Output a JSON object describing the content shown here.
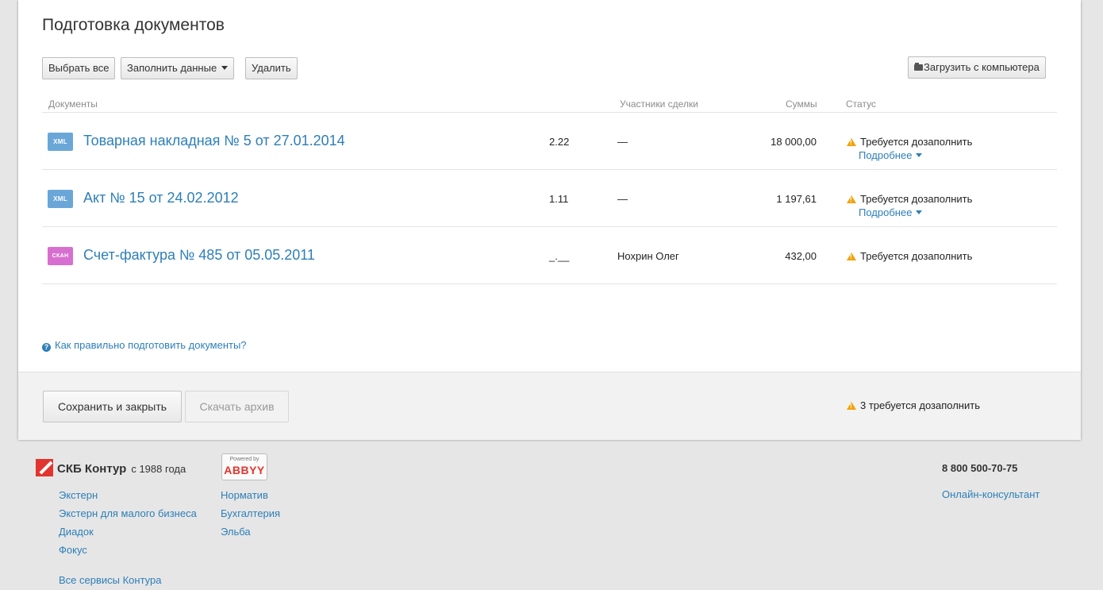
{
  "page": {
    "title": "Подготовка документов"
  },
  "toolbar": {
    "select_all": "Выбрать все",
    "fill_data": "Заполнить данные",
    "delete": "Удалить",
    "upload": "Загрузить с компьютера"
  },
  "table": {
    "headers": {
      "documents": "Документы",
      "participants": "Участники сделки",
      "sums": "Суммы",
      "status": "Статус"
    },
    "rows": [
      {
        "badge": "XML",
        "badge_color": "#6aa7d8",
        "title": "Товарная накладная № 5 от 27.01.2014",
        "version": "2.22",
        "participant": "—",
        "sum": "18 000,00",
        "status": "Требуется дозаполнить",
        "more": "Подробнее"
      },
      {
        "badge": "XML",
        "badge_color": "#6aa7d8",
        "title": "Акт № 15 от 24.02.2012",
        "version": "1.11",
        "participant": "—",
        "sum": "1 197,61",
        "status": "Требуется дозаполнить",
        "more": "Подробнее"
      },
      {
        "badge": "СКАН",
        "badge_color": "#d86fd0",
        "title": "Счет-фактура № 485 от 05.05.2011",
        "version": "_.__",
        "participant": "Нохрин Олег",
        "sum": "432,00",
        "status": "Требуется дозаполнить",
        "more": ""
      }
    ]
  },
  "help": {
    "text": "Как правильно подготовить документы?"
  },
  "actions": {
    "save_close": "Сохранить и закрыть",
    "download_archive": "Скачать архив",
    "summary": "3 требуется дозаполнить"
  },
  "footer": {
    "brand": "СКБ Контур",
    "since": "с 1988 года",
    "col1": [
      "Экстерн",
      "Экстерн для малого бизнеса",
      "Диадок",
      "Фокус"
    ],
    "all_services": "Все сервисы Контура",
    "col2": [
      "Норматив",
      "Бухгалтерия",
      "Эльба"
    ],
    "abbyy_powered": "Powered by",
    "abbyy_name": "ABBYY",
    "phone": "8 800 500-70-75",
    "consultant": "Онлайн-консультант"
  },
  "colors": {
    "accent": "#2d7fb8",
    "warning": "#f0a30a",
    "brand": "#e3352f"
  }
}
